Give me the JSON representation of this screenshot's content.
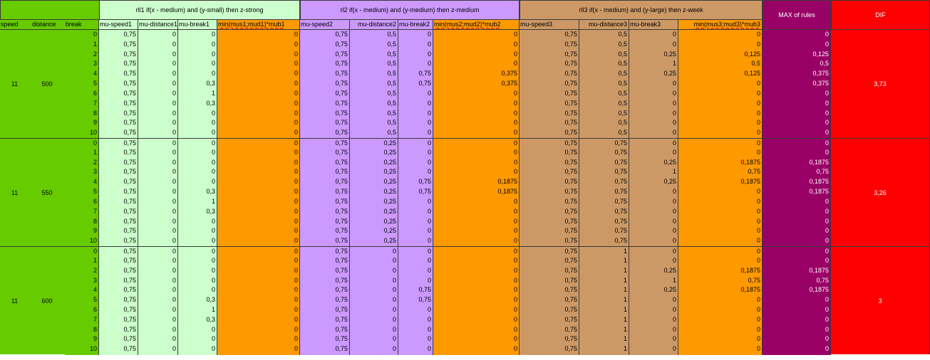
{
  "header": {
    "speed_label": "speed",
    "distance_label": "distance",
    "break_label": "break",
    "rule1_text": "rll1 if(x - medium) and (y-small) then z-strong",
    "rule2_text": "rl2 if(x - medium) and (y-medium) then z-medium",
    "rule3_text": "rll3 if(x - medium) and (y-large) then z-week",
    "max_label": "MAX of rules",
    "dif_label": "DIF",
    "col_labels": [
      "mu-speed1",
      "mu-distance1",
      "mu-break1",
      "min(mus1;mud1)*mub1",
      "mu-speed2",
      "mu-distance2",
      "mu-break2",
      "min(mus2;mud2)*mub2",
      "mu-speed3",
      "mu-distance3",
      "mu-break3",
      "min(mus3;mud3)*mub3"
    ]
  },
  "colors": {
    "green": "#66cc00",
    "light_green": "#ccffcc",
    "purple": "#cc99ff",
    "tan": "#cc9966",
    "orange": "#ff9900",
    "magenta": "#990066",
    "red": "#ff0000"
  },
  "groups": [
    {
      "speed": "11",
      "distance": "500",
      "dif": "3,73",
      "rows": [
        [
          "0",
          "0,75",
          "0",
          "0",
          "0",
          "0,75",
          "0,5",
          "0",
          "0",
          "0,75",
          "0,5",
          "0",
          "0",
          "0"
        ],
        [
          "1",
          "0,75",
          "0",
          "0",
          "0",
          "0,75",
          "0,5",
          "0",
          "0",
          "0,75",
          "0,5",
          "0",
          "0",
          "0"
        ],
        [
          "2",
          "0,75",
          "0",
          "0",
          "0",
          "0,75",
          "0,5",
          "0",
          "0",
          "0,75",
          "0,5",
          "0,25",
          "0,125",
          "0,125"
        ],
        [
          "3",
          "0,75",
          "0",
          "0",
          "0",
          "0,75",
          "0,5",
          "0",
          "0",
          "0,75",
          "0,5",
          "1",
          "0,5",
          "0,5"
        ],
        [
          "4",
          "0,75",
          "0",
          "0",
          "0",
          "0,75",
          "0,5",
          "0,75",
          "0,375",
          "0,75",
          "0,5",
          "0,25",
          "0,125",
          "0,375"
        ],
        [
          "5",
          "0,75",
          "0",
          "0,3",
          "0",
          "0,75",
          "0,5",
          "0,75",
          "0,375",
          "0,75",
          "0,5",
          "0",
          "0",
          "0,375"
        ],
        [
          "6",
          "0,75",
          "0",
          "1",
          "0",
          "0,75",
          "0,5",
          "0",
          "0",
          "0,75",
          "0,5",
          "0",
          "0",
          "0"
        ],
        [
          "7",
          "0,75",
          "0",
          "0,3",
          "0",
          "0,75",
          "0,5",
          "0",
          "0",
          "0,75",
          "0,5",
          "0",
          "0",
          "0"
        ],
        [
          "8",
          "0,75",
          "0",
          "0",
          "0",
          "0,75",
          "0,5",
          "0",
          "0",
          "0,75",
          "0,5",
          "0",
          "0",
          "0"
        ],
        [
          "9",
          "0,75",
          "0",
          "0",
          "0",
          "0,75",
          "0,5",
          "0",
          "0",
          "0,75",
          "0,5",
          "0",
          "0",
          "0"
        ],
        [
          "10",
          "0,75",
          "0",
          "0",
          "0",
          "0,75",
          "0,5",
          "0",
          "0",
          "0,75",
          "0,5",
          "0",
          "0",
          "0"
        ]
      ]
    },
    {
      "speed": "11",
      "distance": "550",
      "dif": "3,26",
      "rows": [
        [
          "0",
          "0,75",
          "0",
          "0",
          "0",
          "0,75",
          "0,25",
          "0",
          "0",
          "0,75",
          "0,75",
          "0",
          "0",
          "0"
        ],
        [
          "1",
          "0,75",
          "0",
          "0",
          "0",
          "0,75",
          "0,25",
          "0",
          "0",
          "0,75",
          "0,75",
          "0",
          "0",
          "0"
        ],
        [
          "2",
          "0,75",
          "0",
          "0",
          "0",
          "0,75",
          "0,25",
          "0",
          "0",
          "0,75",
          "0,75",
          "0,25",
          "0,1875",
          "0,1875"
        ],
        [
          "3",
          "0,75",
          "0",
          "0",
          "0",
          "0,75",
          "0,25",
          "0",
          "0",
          "0,75",
          "0,75",
          "1",
          "0,75",
          "0,75"
        ],
        [
          "4",
          "0,75",
          "0",
          "0",
          "0",
          "0,75",
          "0,25",
          "0,75",
          "0,1875",
          "0,75",
          "0,75",
          "0,25",
          "0,1875",
          "0,1875"
        ],
        [
          "5",
          "0,75",
          "0",
          "0,3",
          "0",
          "0,75",
          "0,25",
          "0,75",
          "0,1875",
          "0,75",
          "0,75",
          "0",
          "0",
          "0,1875"
        ],
        [
          "6",
          "0,75",
          "0",
          "1",
          "0",
          "0,75",
          "0,25",
          "0",
          "0",
          "0,75",
          "0,75",
          "0",
          "0",
          "0"
        ],
        [
          "7",
          "0,75",
          "0",
          "0,3",
          "0",
          "0,75",
          "0,25",
          "0",
          "0",
          "0,75",
          "0,75",
          "0",
          "0",
          "0"
        ],
        [
          "8",
          "0,75",
          "0",
          "0",
          "0",
          "0,75",
          "0,25",
          "0",
          "0",
          "0,75",
          "0,75",
          "0",
          "0",
          "0"
        ],
        [
          "9",
          "0,75",
          "0",
          "0",
          "0",
          "0,75",
          "0,25",
          "0",
          "0",
          "0,75",
          "0,75",
          "0",
          "0",
          "0"
        ],
        [
          "10",
          "0,75",
          "0",
          "0",
          "0",
          "0,75",
          "0,25",
          "0",
          "0",
          "0,75",
          "0,75",
          "0",
          "0",
          "0"
        ]
      ]
    },
    {
      "speed": "11",
      "distance": "600",
      "dif": "3",
      "rows": [
        [
          "0",
          "0,75",
          "0",
          "0",
          "0",
          "0,75",
          "0",
          "0",
          "0",
          "0,75",
          "1",
          "0",
          "0",
          "0"
        ],
        [
          "1",
          "0,75",
          "0",
          "0",
          "0",
          "0,75",
          "0",
          "0",
          "0",
          "0,75",
          "1",
          "0",
          "0",
          "0"
        ],
        [
          "2",
          "0,75",
          "0",
          "0",
          "0",
          "0,75",
          "0",
          "0",
          "0",
          "0,75",
          "1",
          "0,25",
          "0,1875",
          "0,1875"
        ],
        [
          "3",
          "0,75",
          "0",
          "0",
          "0",
          "0,75",
          "0",
          "0",
          "0",
          "0,75",
          "1",
          "1",
          "0,75",
          "0,75"
        ],
        [
          "4",
          "0,75",
          "0",
          "0",
          "0",
          "0,75",
          "0",
          "0,75",
          "0",
          "0,75",
          "1",
          "0,25",
          "0,1875",
          "0,1875"
        ],
        [
          "5",
          "0,75",
          "0",
          "0,3",
          "0",
          "0,75",
          "0",
          "0,75",
          "0",
          "0,75",
          "1",
          "0",
          "0",
          "0"
        ],
        [
          "6",
          "0,75",
          "0",
          "1",
          "0",
          "0,75",
          "0",
          "0",
          "0",
          "0,75",
          "1",
          "0",
          "0",
          "0"
        ],
        [
          "7",
          "0,75",
          "0",
          "0,3",
          "0",
          "0,75",
          "0",
          "0",
          "0",
          "0,75",
          "1",
          "0",
          "0",
          "0"
        ],
        [
          "8",
          "0,75",
          "0",
          "0",
          "0",
          "0,75",
          "0",
          "0",
          "0",
          "0,75",
          "1",
          "0",
          "0",
          "0"
        ],
        [
          "9",
          "0,75",
          "0",
          "0",
          "0",
          "0,75",
          "0",
          "0",
          "0",
          "0,75",
          "1",
          "0",
          "0",
          "0"
        ],
        [
          "10",
          "0,75",
          "0",
          "0",
          "0",
          "0,75",
          "0",
          "0",
          "0",
          "0,75",
          "1",
          "0",
          "0",
          "0"
        ]
      ]
    }
  ]
}
